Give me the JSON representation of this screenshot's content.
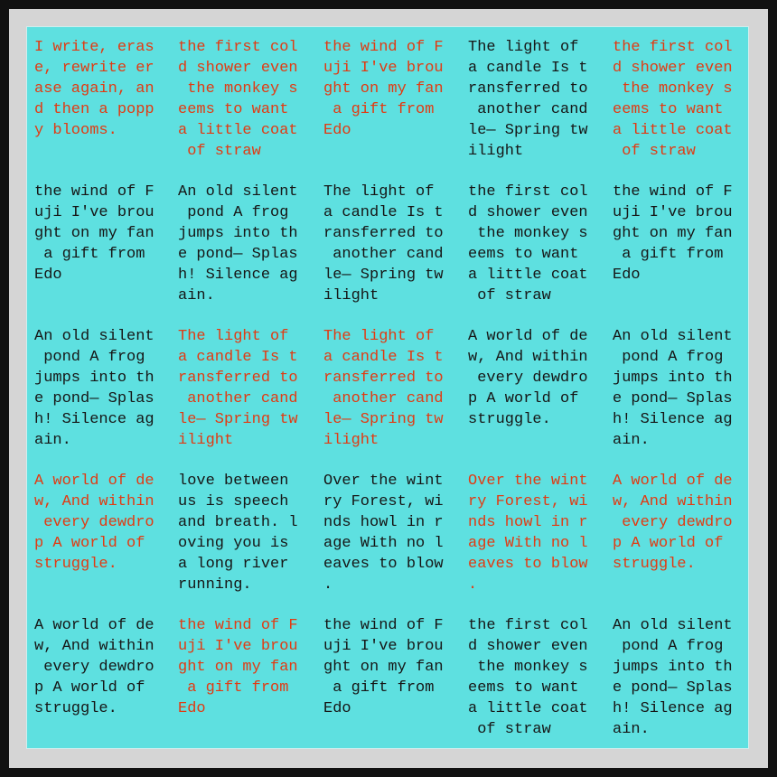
{
  "colors": {
    "background": "#5ee0e0",
    "text_black": "#161616",
    "text_red": "#e23a12"
  },
  "grid": [
    [
      {
        "color": "red",
        "text": "I write, eras\ne, rewrite er\nase again, an\nd then a popp\ny blooms."
      },
      {
        "color": "red",
        "text": "the first col\nd shower even\n the monkey s\neems to want\na little coat\n of straw"
      },
      {
        "color": "red",
        "text": "the wind of F\nuji I've brou\nght on my fan\n a gift from\nEdo"
      },
      {
        "color": "black",
        "text": "The light of\na candle Is t\nransferred to\n another cand\nle— Spring tw\nilight"
      },
      {
        "color": "red",
        "text": "the first col\nd shower even\n the monkey s\neems to want\na little coat\n of straw"
      }
    ],
    [
      {
        "color": "black",
        "text": "the wind of F\nuji I've brou\nght on my fan\n a gift from\nEdo"
      },
      {
        "color": "black",
        "text": "An old silent\n pond A frog\njumps into th\ne pond— Splas\nh! Silence ag\nain."
      },
      {
        "color": "black",
        "text": "The light of\na candle Is t\nransferred to\n another cand\nle— Spring tw\nilight"
      },
      {
        "color": "black",
        "text": "the first col\nd shower even\n the monkey s\neems to want\na little coat\n of straw"
      },
      {
        "color": "black",
        "text": "the wind of F\nuji I've brou\nght on my fan\n a gift from\nEdo"
      }
    ],
    [
      {
        "color": "black",
        "text": "An old silent\n pond A frog\njumps into th\ne pond— Splas\nh! Silence ag\nain."
      },
      {
        "color": "red",
        "text": "The light of\na candle Is t\nransferred to\n another cand\nle— Spring tw\nilight"
      },
      {
        "color": "red",
        "text": "The light of\na candle Is t\nransferred to\n another cand\nle— Spring tw\nilight"
      },
      {
        "color": "black",
        "text": "A world of de\nw, And within\n every dewdro\np A world of\nstruggle."
      },
      {
        "color": "black",
        "text": "An old silent\n pond A frog\njumps into th\ne pond— Splas\nh! Silence ag\nain."
      }
    ],
    [
      {
        "color": "red",
        "text": "A world of de\nw, And within\n every dewdro\np A world of\nstruggle."
      },
      {
        "color": "black",
        "text": "love between\nus is speech\nand breath. l\noving you is\na long river\nrunning."
      },
      {
        "color": "black",
        "text": "Over the wint\nry Forest, wi\nnds howl in r\nage With no l\neaves to blow\n."
      },
      {
        "color": "red",
        "text": "Over the wint\nry Forest, wi\nnds howl in r\nage With no l\neaves to blow\n."
      },
      {
        "color": "red",
        "text": "A world of de\nw, And within\n every dewdro\np A world of\nstruggle."
      }
    ],
    [
      {
        "color": "black",
        "text": "A world of de\nw, And within\n every dewdro\np A world of\nstruggle."
      },
      {
        "color": "red",
        "text": "the wind of F\nuji I've brou\nght on my fan\n a gift from\nEdo"
      },
      {
        "color": "black",
        "text": "the wind of F\nuji I've brou\nght on my fan\n a gift from\nEdo"
      },
      {
        "color": "black",
        "text": "the first col\nd shower even\n the monkey s\neems to want\na little coat\n of straw"
      },
      {
        "color": "black",
        "text": "An old silent\n pond A frog\njumps into th\ne pond— Splas\nh! Silence ag\nain."
      }
    ]
  ]
}
